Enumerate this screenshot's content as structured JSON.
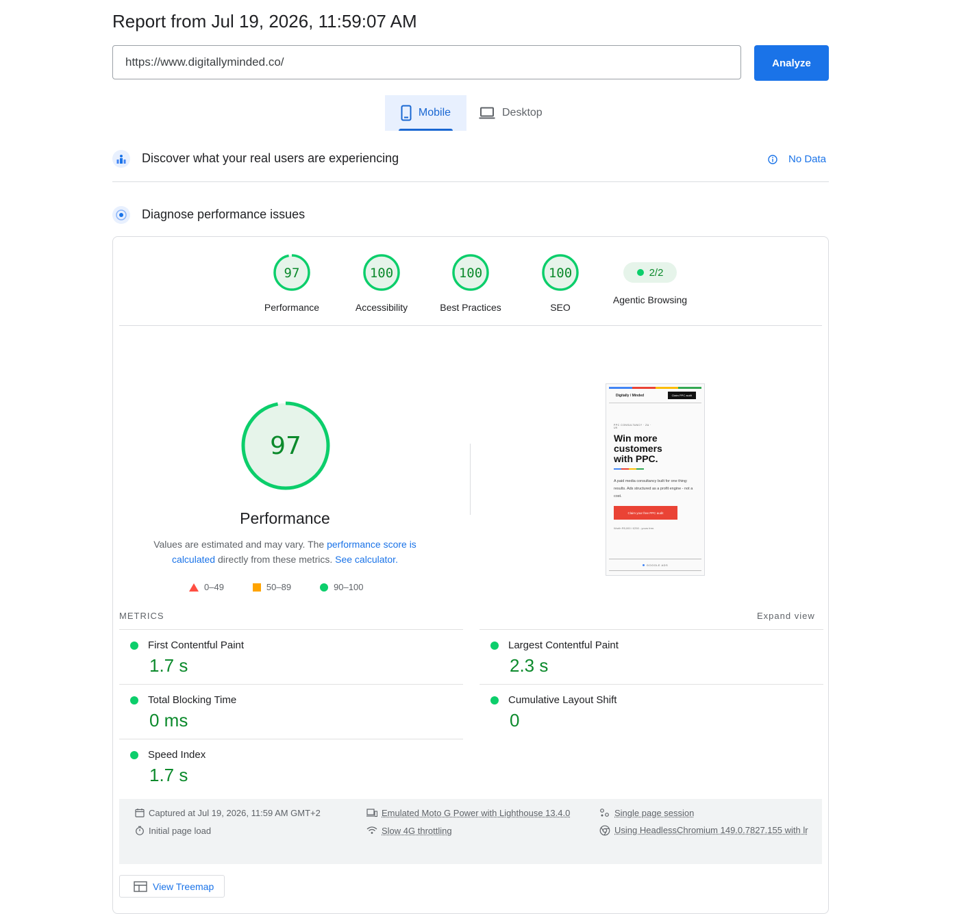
{
  "header": {
    "title": "Report from Jul 19, 2026, 11:59:07 AM",
    "url_value": "https://www.digitallyminded.co/",
    "analyze_label": "Analyze"
  },
  "tabs": [
    {
      "label": "Mobile",
      "icon": "smartphone-icon",
      "active": true
    },
    {
      "label": "Desktop",
      "icon": "laptop-icon",
      "active": false
    }
  ],
  "field_data": {
    "title": "Discover what your real users are experiencing",
    "status_label": "No Data"
  },
  "diagnose": {
    "title": "Diagnose performance issues"
  },
  "categories": [
    {
      "label": "Performance",
      "score": "97"
    },
    {
      "label": "Accessibility",
      "score": "100"
    },
    {
      "label": "Best Practices",
      "score": "100"
    },
    {
      "label": "SEO",
      "score": "100"
    },
    {
      "label": "Agentic Browsing",
      "score": "2/2"
    }
  ],
  "performance": {
    "score": "97",
    "label": "Performance",
    "desc_text_1": "Values are estimated and may vary. The ",
    "desc_link_1": "performance score is calculated",
    "desc_text_2": " directly from these metrics. ",
    "desc_link_2": "See calculator."
  },
  "legend": {
    "fail": "0–49",
    "average": "50–89",
    "pass": "90–100"
  },
  "metrics": {
    "heading": "METRICS",
    "expand_label": "Expand view",
    "items": [
      {
        "name": "First Contentful Paint",
        "value": "1.7 s"
      },
      {
        "name": "Largest Contentful Paint",
        "value": "2.3 s"
      },
      {
        "name": "Total Blocking Time",
        "value": "0 ms"
      },
      {
        "name": "Cumulative Layout Shift",
        "value": "0"
      },
      {
        "name": "Speed Index",
        "value": "1.7 s"
      }
    ]
  },
  "screenshot": {
    "brand": "Digitally / Minded",
    "cta_top": "Claim PPC audit",
    "eyebrow": "PPC CONSULTANCY · ZA · UK",
    "headline": "Win more customers with PPC.",
    "body": "A paid media consultancy built for one thing: results. Ads structured as a profit engine - not a cost.",
    "cta": "Claim your free PPC audit",
    "small": "Worth R5,000 / £250 - yours free.",
    "footer": "GOOGLE ADS"
  },
  "footer_info": {
    "captured": "Captured at Jul 19, 2026, 11:59 AM GMT+2",
    "load": "Initial page load",
    "device": "Emulated Moto G Power with Lighthouse 13.4.0",
    "throttling": "Slow 4G throttling",
    "session": "Single page session",
    "browser": "Using HeadlessChromium 149.0.7827.155 with lr"
  },
  "treemap_label": "View Treemap",
  "colors": {
    "accent": "#1a73e8",
    "pass": "#0cce6b",
    "pass_text": "#0c8a2c",
    "average": "#ffa400",
    "fail": "#ff4e42"
  }
}
